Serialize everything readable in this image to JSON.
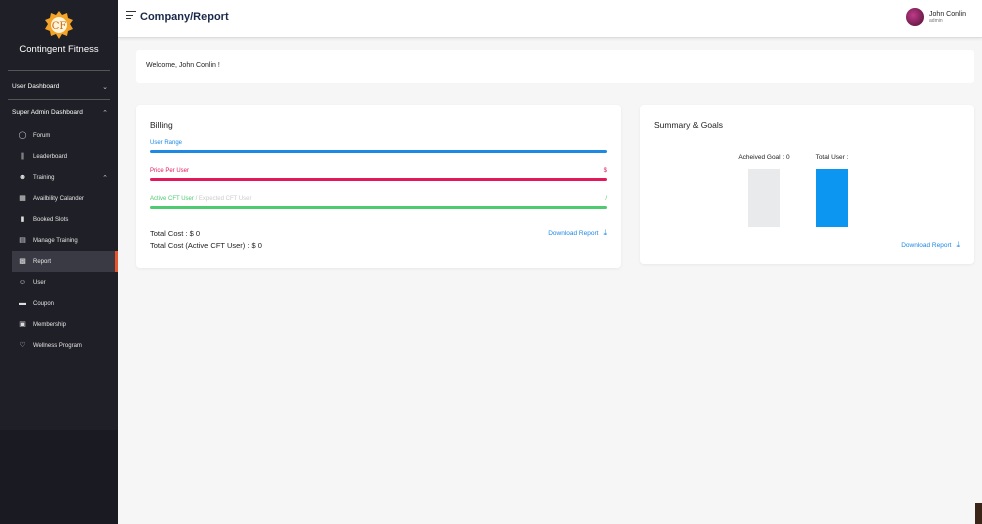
{
  "brand": {
    "name": "Contingent Fitness"
  },
  "sidebar": {
    "sections": [
      {
        "label": "User Dashboard",
        "chevron": "chevron-down-icon"
      },
      {
        "label": "Super Admin Dashboard",
        "chevron": "chevron-up-icon"
      }
    ],
    "items": [
      {
        "label": "Forum",
        "icon": "forum-icon"
      },
      {
        "label": "Leaderboard",
        "icon": "leaderboard-icon"
      },
      {
        "label": "Training",
        "icon": "training-icon"
      },
      {
        "label": "Availbility Calander",
        "icon": "calendar-icon"
      },
      {
        "label": "Booked Slots",
        "icon": "booked-slots-icon"
      },
      {
        "label": "Manage Training",
        "icon": "manage-training-icon"
      },
      {
        "label": "Report",
        "icon": "report-icon"
      },
      {
        "label": "User",
        "icon": "user-icon"
      },
      {
        "label": "Coupon",
        "icon": "coupon-icon"
      },
      {
        "label": "Membership",
        "icon": "membership-icon"
      },
      {
        "label": "Wellness Program",
        "icon": "wellness-icon"
      }
    ]
  },
  "header": {
    "title": "Company/Report",
    "user_name": "John Conlin",
    "user_role": "admin"
  },
  "welcome": "Welcome, John Conlin !",
  "billing": {
    "title": "Billing",
    "user_range": "User Range",
    "price_per_user": "Price Per User",
    "price_symbol": "$",
    "active_cft": "Active CFT User",
    "separator": "/",
    "expected_cft": "Expected CFT User",
    "active_right": "/",
    "total_cost": "Total Cost : $ 0",
    "total_cost_active": "Total Cost (Active CFT User) : $ 0",
    "download": "Download Report"
  },
  "summary": {
    "title": "Summary & Goals",
    "download": "Download Report"
  },
  "chart_data": {
    "type": "bar",
    "categories": [
      "Acheived Goal : 0",
      "Total User :"
    ],
    "values": [
      1,
      1
    ],
    "colors": [
      "#e9eaec",
      "#0c96f2"
    ]
  },
  "colors": {
    "blue": "#1e88e5",
    "red": "#e3185b",
    "green": "#4ecb71"
  }
}
